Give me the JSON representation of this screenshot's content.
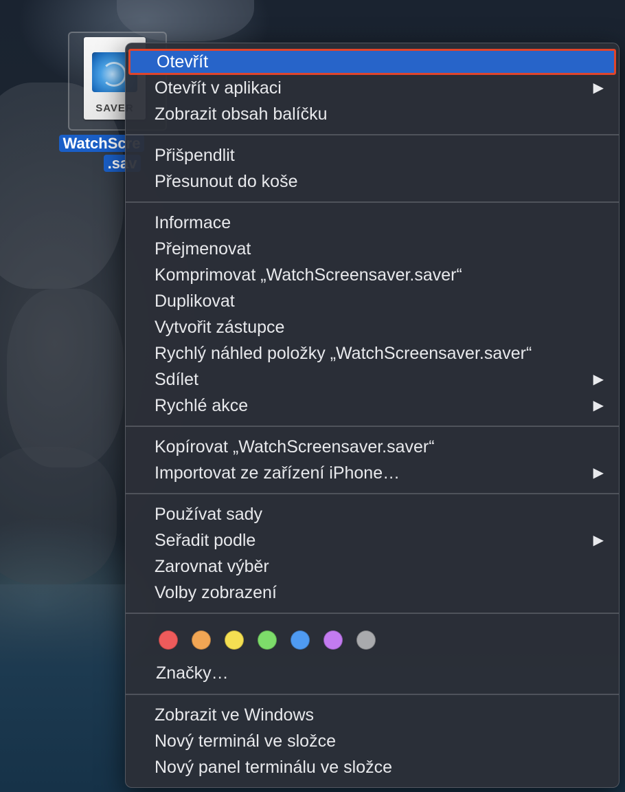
{
  "desktop": {
    "file_icon_ext": "SAVER",
    "file_name_line1": "WatchScre",
    "file_name_line2": ".sav"
  },
  "menu": {
    "group1": [
      {
        "label": "Otevřít",
        "highlighted": true,
        "submenu": false
      },
      {
        "label": "Otevřít v aplikaci",
        "submenu": true
      },
      {
        "label": "Zobrazit obsah balíčku",
        "submenu": false
      }
    ],
    "group2": [
      {
        "label": "Přišpendlit",
        "submenu": false
      },
      {
        "label": "Přesunout do koše",
        "submenu": false
      }
    ],
    "group3": [
      {
        "label": "Informace",
        "submenu": false
      },
      {
        "label": "Přejmenovat",
        "submenu": false
      },
      {
        "label": "Komprimovat „WatchScreensaver.saver“",
        "submenu": false
      },
      {
        "label": "Duplikovat",
        "submenu": false
      },
      {
        "label": "Vytvořit zástupce",
        "submenu": false
      },
      {
        "label": "Rychlý náhled položky „WatchScreensaver.saver“",
        "submenu": false
      },
      {
        "label": "Sdílet",
        "submenu": true
      },
      {
        "label": "Rychlé akce",
        "submenu": true
      }
    ],
    "group4": [
      {
        "label": "Kopírovat „WatchScreensaver.saver“",
        "submenu": false
      },
      {
        "label": "Importovat ze zařízení iPhone…",
        "submenu": true
      }
    ],
    "group5": [
      {
        "label": "Používat sady",
        "submenu": false
      },
      {
        "label": "Seřadit podle",
        "submenu": true
      },
      {
        "label": "Zarovnat výběr",
        "submenu": false
      },
      {
        "label": "Volby zobrazení",
        "submenu": false
      }
    ],
    "tags": {
      "colors": [
        {
          "name": "red",
          "hex": "#ee5b5b"
        },
        {
          "name": "orange",
          "hex": "#f2a654"
        },
        {
          "name": "yellow",
          "hex": "#f4df52"
        },
        {
          "name": "green",
          "hex": "#7ddc6a"
        },
        {
          "name": "blue",
          "hex": "#4f9bf2"
        },
        {
          "name": "purple",
          "hex": "#c37bf0"
        },
        {
          "name": "gray",
          "hex": "#a9aaad"
        }
      ],
      "label": "Značky…"
    },
    "group7": [
      {
        "label": "Zobrazit ve Windows",
        "submenu": false
      },
      {
        "label": "Nový terminál ve složce",
        "submenu": false
      },
      {
        "label": "Nový panel terminálu ve složce",
        "submenu": false
      }
    ],
    "submenu_arrow": "▶",
    "highlight_color": "#2764c9",
    "highlight_outline_color": "#e0452b"
  }
}
